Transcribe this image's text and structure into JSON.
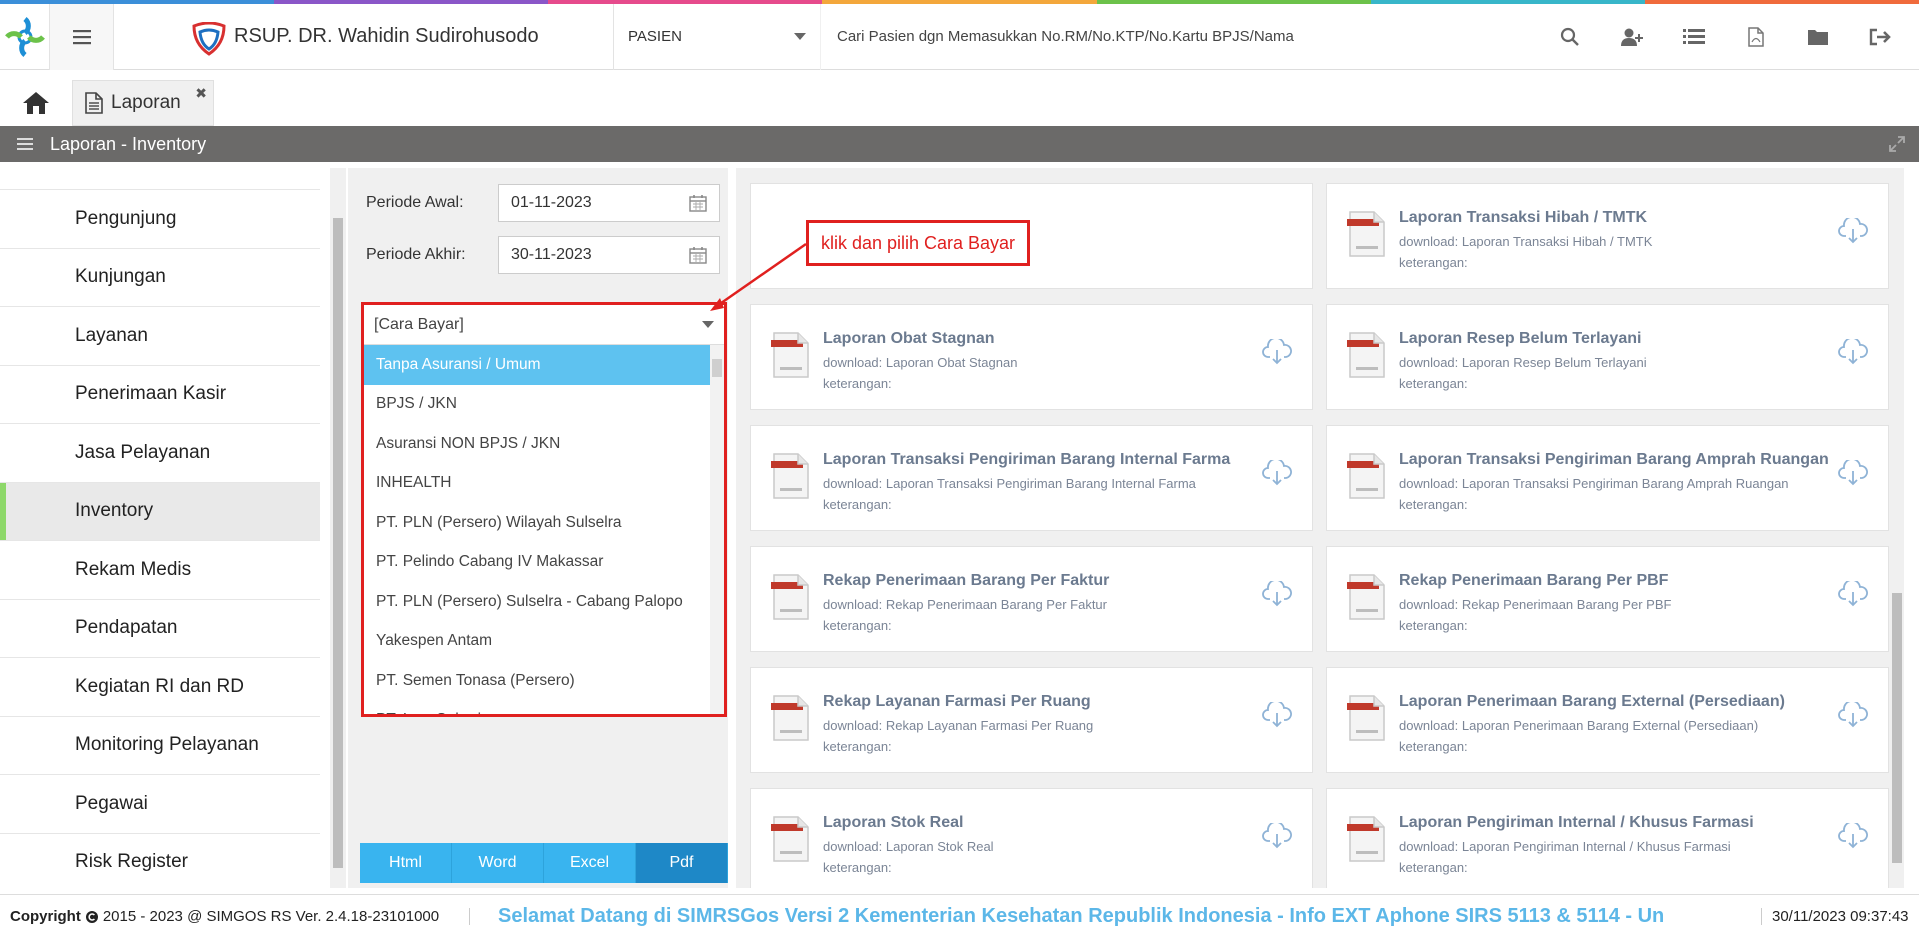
{
  "colors": {
    "strip": [
      "#3b8fd9",
      "#8a56c8",
      "#e64b8c",
      "#f3a73b",
      "#6cc24a",
      "#38b6c9",
      "#f06b3c"
    ],
    "accent_red": "#e0201f",
    "selected_option": "#5ec2f0",
    "export_button": "#39b4ef"
  },
  "header": {
    "hospital_name": "RSUP. DR. Wahidin Sudirohusodo",
    "patient_selector": "PASIEN",
    "search_placeholder": "Cari Pasien dgn Memasukkan No.RM/No.KTP/No.Kartu BPJS/Nama",
    "icons": [
      "search-icon",
      "add-user-icon",
      "list-icon",
      "pdf-file-icon",
      "folder-icon",
      "sign-out-icon"
    ]
  },
  "tabs": [
    {
      "label": "Laporan"
    }
  ],
  "titlebar": {
    "title": "Laporan - Inventory"
  },
  "sidebar": {
    "items": [
      {
        "label": "Pengunjung"
      },
      {
        "label": "Kunjungan"
      },
      {
        "label": "Layanan"
      },
      {
        "label": "Penerimaan Kasir"
      },
      {
        "label": "Jasa Pelayanan"
      },
      {
        "label": "Inventory",
        "active": true
      },
      {
        "label": "Rekam Medis"
      },
      {
        "label": "Pendapatan"
      },
      {
        "label": "Kegiatan RI dan RD"
      },
      {
        "label": "Monitoring Pelayanan"
      },
      {
        "label": "Pegawai"
      },
      {
        "label": "Risk Register"
      }
    ]
  },
  "filter": {
    "periode_awal_label": "Periode Awal:",
    "periode_awal_value": "01-11-2023",
    "periode_akhir_label": "Periode Akhir:",
    "periode_akhir_value": "30-11-2023",
    "cara_bayar_placeholder": "[Cara Bayar]",
    "cara_bayar_options": [
      "Tanpa Asuransi / Umum",
      "BPJS / JKN",
      "Asuransi NON BPJS / JKN",
      "INHEALTH",
      "PT. PLN (Persero) Wilayah Sulselra",
      "PT. Pelindo Cabang IV Makassar",
      "PT. PLN (Persero) Sulselra - Cabang Palopo",
      "Yakespen Antam",
      "PT. Semen Tonasa (Persero)",
      "PT. Inco Sahari"
    ],
    "export_buttons": [
      "Html",
      "Word",
      "Excel",
      "Pdf"
    ]
  },
  "annotation": {
    "text": "klik dan pilih Cara Bayar"
  },
  "reports": [
    {
      "title": "Laporan Transaksi Hibah / TMTK",
      "download": "download: Laporan Transaksi Hibah / TMTK",
      "keterangan": "keterangan:"
    },
    {
      "title": "Laporan Obat Stagnan",
      "download": "download: Laporan Obat Stagnan",
      "keterangan": "keterangan:"
    },
    {
      "title": "Laporan Resep Belum Terlayani",
      "download": "download: Laporan Resep Belum Terlayani",
      "keterangan": "keterangan:"
    },
    {
      "title": "Laporan Transaksi Pengiriman Barang Internal Farma",
      "download": "download: Laporan Transaksi Pengiriman Barang Internal Farma",
      "keterangan": "keterangan:"
    },
    {
      "title": "Laporan Transaksi Pengiriman Barang Amprah Ruangan",
      "download": "download: Laporan Transaksi Pengiriman Barang Amprah Ruangan",
      "keterangan": "keterangan:"
    },
    {
      "title": "Rekap Penerimaan Barang Per Faktur",
      "download": "download: Rekap Penerimaan Barang Per Faktur",
      "keterangan": "keterangan:"
    },
    {
      "title": "Rekap Penerimaan Barang Per PBF",
      "download": "download: Rekap Penerimaan Barang Per PBF",
      "keterangan": "keterangan:"
    },
    {
      "title": "Rekap Layanan Farmasi Per Ruang",
      "download": "download: Rekap Layanan Farmasi Per Ruang",
      "keterangan": "keterangan:"
    },
    {
      "title": "Laporan Penerimaan Barang External (Persediaan)",
      "download": "download: Laporan Penerimaan Barang External (Persediaan)",
      "keterangan": "keterangan:"
    },
    {
      "title": "Laporan Stok Real",
      "download": "download: Laporan Stok Real",
      "keterangan": "keterangan:"
    },
    {
      "title": "Laporan Pengiriman Internal / Khusus Farmasi",
      "download": "download: Laporan Pengiriman Internal / Khusus Farmasi",
      "keterangan": "keterangan:"
    }
  ],
  "footer": {
    "copyright": "Copyright",
    "version": "2015 - 2023 @ SIMGOS RS Ver. 2.4.18-23101000",
    "ticker": "Selamat Datang di SIMRSGos Versi 2 Kementerian Kesehatan Republik Indonesia - Info EXT Aphone SIRS 5113 & 5114 - Un",
    "datetime": "30/11/2023 09:37:43"
  }
}
